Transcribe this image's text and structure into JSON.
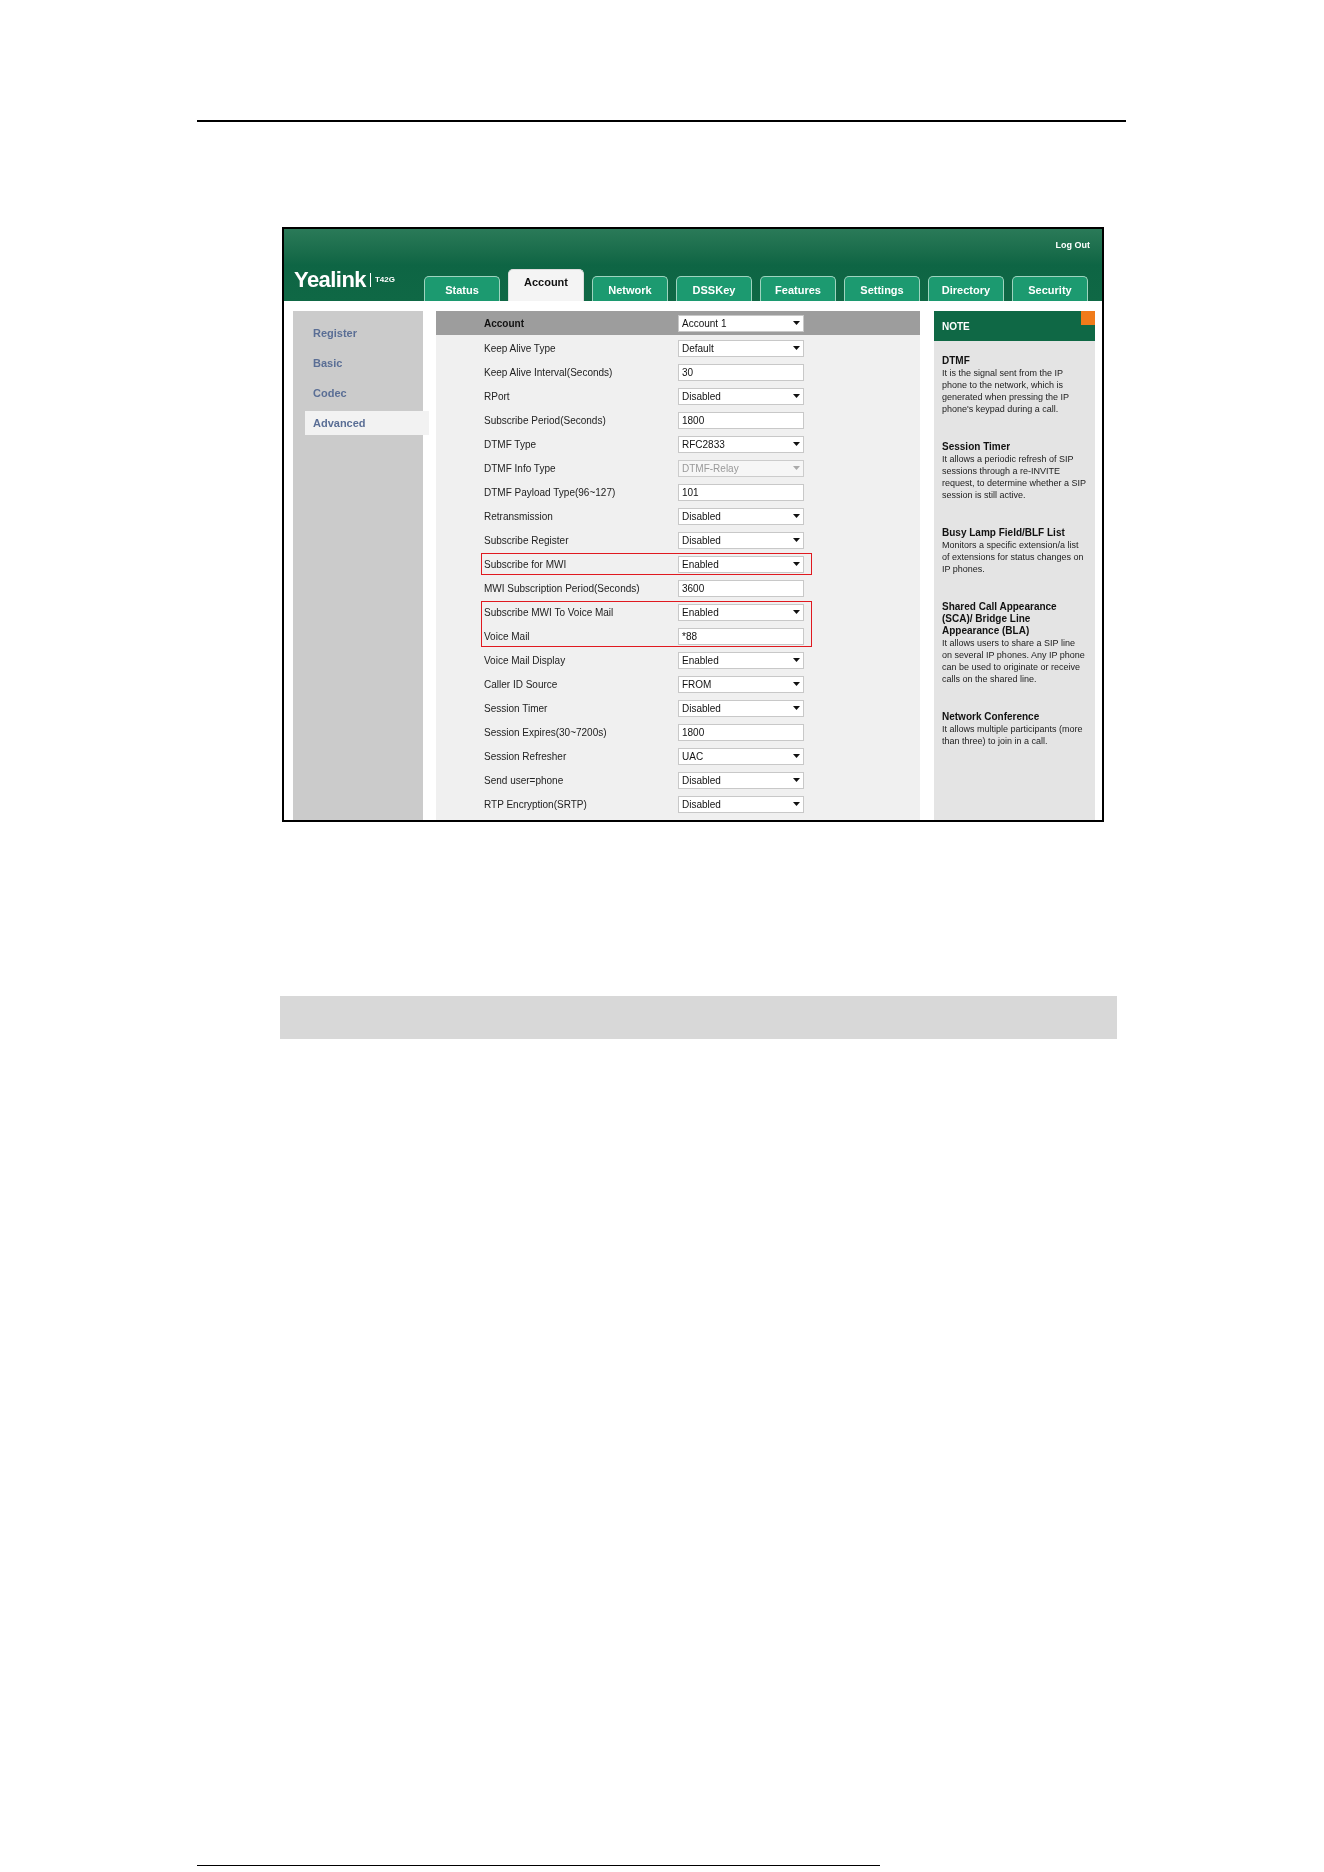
{
  "header": {
    "logo": "Yealink",
    "model": "T42G",
    "logout": "Log Out"
  },
  "tabs": [
    {
      "label": "Status",
      "selected": false
    },
    {
      "label": "Account",
      "selected": true
    },
    {
      "label": "Network",
      "selected": false
    },
    {
      "label": "DSSKey",
      "selected": false
    },
    {
      "label": "Features",
      "selected": false
    },
    {
      "label": "Settings",
      "selected": false
    },
    {
      "label": "Directory",
      "selected": false
    },
    {
      "label": "Security",
      "selected": false
    }
  ],
  "sidebar": {
    "items": [
      {
        "label": "Register",
        "selected": false
      },
      {
        "label": "Basic",
        "selected": false
      },
      {
        "label": "Codec",
        "selected": false
      },
      {
        "label": "Advanced",
        "selected": true
      }
    ]
  },
  "form": {
    "header": {
      "label": "Account",
      "value": "Account 1"
    },
    "rows": [
      {
        "label": "Keep Alive Type",
        "kind": "select",
        "value": "Default",
        "disabled": false,
        "highlighted": false
      },
      {
        "label": "Keep Alive Interval(Seconds)",
        "kind": "text",
        "value": "30",
        "disabled": false,
        "highlighted": false
      },
      {
        "label": "RPort",
        "kind": "select",
        "value": "Disabled",
        "disabled": false,
        "highlighted": false
      },
      {
        "label": "Subscribe Period(Seconds)",
        "kind": "text",
        "value": "1800",
        "disabled": false,
        "highlighted": false
      },
      {
        "label": "DTMF Type",
        "kind": "select",
        "value": "RFC2833",
        "disabled": false,
        "highlighted": false
      },
      {
        "label": "DTMF Info Type",
        "kind": "select",
        "value": "DTMF-Relay",
        "disabled": true,
        "highlighted": false
      },
      {
        "label": "DTMF Payload Type(96~127)",
        "kind": "text",
        "value": "101",
        "disabled": false,
        "highlighted": false
      },
      {
        "label": "Retransmission",
        "kind": "select",
        "value": "Disabled",
        "disabled": false,
        "highlighted": false
      },
      {
        "label": "Subscribe Register",
        "kind": "select",
        "value": "Disabled",
        "disabled": false,
        "highlighted": false
      },
      {
        "label": "Subscribe for MWI",
        "kind": "select",
        "value": "Enabled",
        "disabled": false,
        "highlighted": true
      },
      {
        "label": "MWI Subscription Period(Seconds)",
        "kind": "text",
        "value": "3600",
        "disabled": false,
        "highlighted": false
      },
      {
        "label": "Subscribe MWI To Voice Mail",
        "kind": "select",
        "value": "Enabled",
        "disabled": false,
        "highlighted": true
      },
      {
        "label": "Voice Mail",
        "kind": "text",
        "value": "*88",
        "disabled": false,
        "highlighted": true
      },
      {
        "label": "Voice Mail Display",
        "kind": "select",
        "value": "Enabled",
        "disabled": false,
        "highlighted": false
      },
      {
        "label": "Caller ID Source",
        "kind": "select",
        "value": "FROM",
        "disabled": false,
        "highlighted": false
      },
      {
        "label": "Session Timer",
        "kind": "select",
        "value": "Disabled",
        "disabled": false,
        "highlighted": false
      },
      {
        "label": "Session Expires(30~7200s)",
        "kind": "text",
        "value": "1800",
        "disabled": false,
        "highlighted": false
      },
      {
        "label": "Session Refresher",
        "kind": "select",
        "value": "UAC",
        "disabled": false,
        "highlighted": false
      },
      {
        "label": "Send user=phone",
        "kind": "select",
        "value": "Disabled",
        "disabled": false,
        "highlighted": false
      },
      {
        "label": "RTP Encryption(SRTP)",
        "kind": "select",
        "value": "Disabled",
        "disabled": false,
        "highlighted": false
      }
    ]
  },
  "note": {
    "title": "NOTE",
    "sections": [
      {
        "title": "DTMF",
        "body": "It is the signal sent from the IP phone to the network, which is generated when pressing the IP phone's keypad during a call."
      },
      {
        "title": "Session Timer",
        "body": "It allows a periodic refresh of SIP sessions through a re-INVITE request, to determine whether a SIP session is still active."
      },
      {
        "title": "Busy Lamp Field/BLF List",
        "body": "Monitors a specific extension/a list of extensions for status changes on IP phones."
      },
      {
        "title": "Shared Call Appearance (SCA)/ Bridge Line Appearance (BLA)",
        "body": "It allows users to share a SIP line on several IP phones. Any IP phone can be used to originate or receive calls on the shared line."
      },
      {
        "title": "Network Conference",
        "body": "It allows multiple participants (more than three) to join in a call."
      }
    ]
  }
}
